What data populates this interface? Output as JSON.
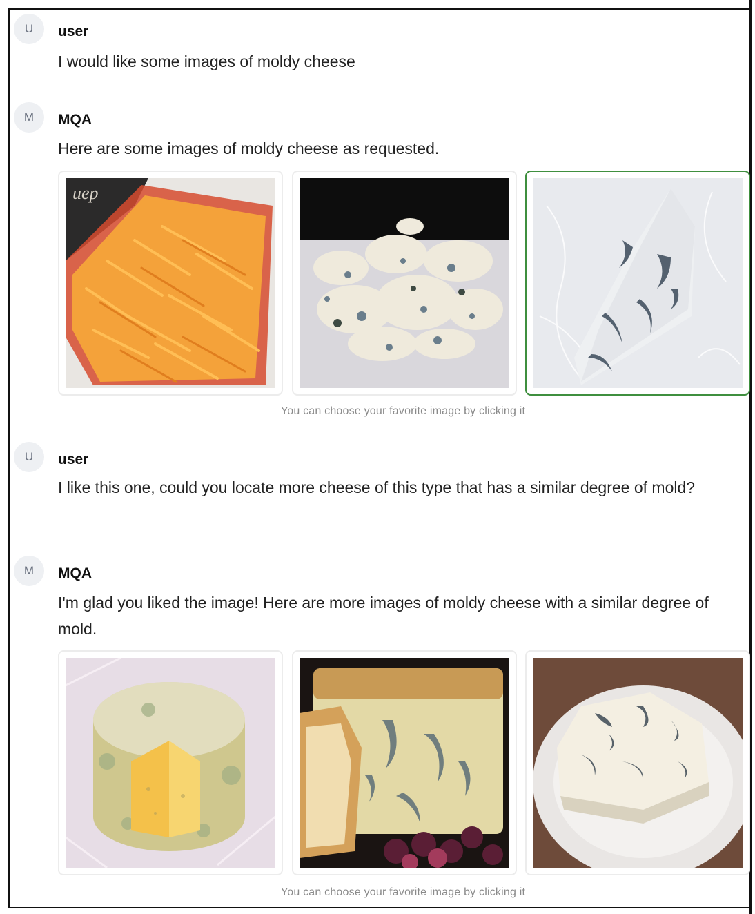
{
  "conversation": {
    "messages": [
      {
        "avatar": "U",
        "sender": "user",
        "text": "I would like some images of moldy cheese"
      },
      {
        "avatar": "M",
        "sender": "MQA",
        "text": "Here are some images of moldy cheese as requested.",
        "images": [
          {
            "icon": "shredded-cheddar-bag-image"
          },
          {
            "icon": "crumbled-blue-cheese-image"
          },
          {
            "icon": "blue-cheese-wedge-in-plastic-image",
            "selected": true
          }
        ],
        "hint": "You can choose your favorite image by clicking it"
      },
      {
        "avatar": "U",
        "sender": "user",
        "text": "I like this one, could you locate more cheese of this type that has a similar degree of mold?"
      },
      {
        "avatar": "M",
        "sender": "MQA",
        "text": "I'm glad you liked the image! Here are more images of moldy cheese with a similar degree of mold.",
        "images": [
          {
            "icon": "moldy-rind-cheese-wheel-image"
          },
          {
            "icon": "blue-stilton-with-grapes-image"
          },
          {
            "icon": "blue-cheese-on-plate-image"
          }
        ],
        "hint": "You can choose your favorite image by clicking it"
      }
    ]
  },
  "colors": {
    "selected_border": "#3f8f3f",
    "hint_text": "#8a8a8a",
    "avatar_bg": "#eef0f3"
  }
}
